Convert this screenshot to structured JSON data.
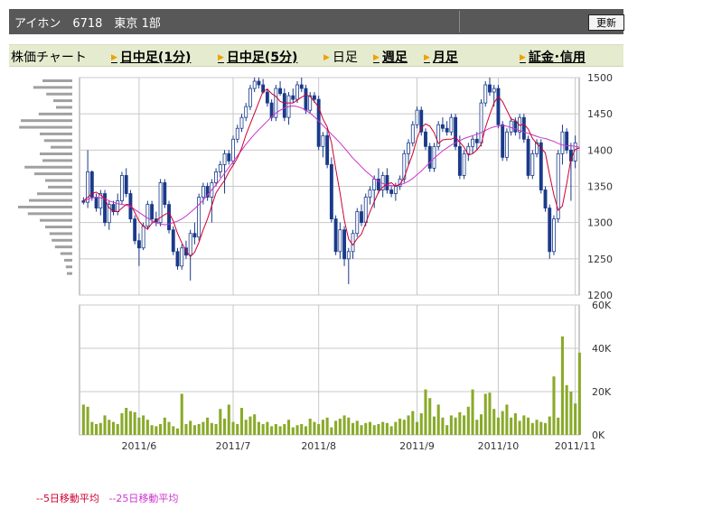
{
  "header": {
    "title": "アイホン　6718　東京 1部",
    "refresh_label": "更新"
  },
  "tabs": [
    {
      "label": "株価チャート",
      "link": false,
      "arrow": false
    },
    {
      "label": "日中足(1分)",
      "link": true,
      "arrow": true
    },
    {
      "label": "日中足(5分)",
      "link": true,
      "arrow": true
    },
    {
      "label": "日足",
      "link": false,
      "arrow": true
    },
    {
      "label": "週足",
      "link": true,
      "arrow": true
    },
    {
      "label": "月足",
      "link": true,
      "arrow": true
    },
    {
      "label": "証金･信用",
      "link": true,
      "arrow": true
    }
  ],
  "colors": {
    "up_candle": "#ffffff",
    "down_candle": "#1a3a8a",
    "ma5": "#cc0033",
    "ma25": "#cc33cc",
    "volume": "#8aaa2a",
    "volume_profile": "#a0a0a0",
    "grid": "#c8c8c8"
  },
  "legend": [
    {
      "label": "--5日移動平均",
      "color": "#cc0033"
    },
    {
      "label": "--25日移動平均",
      "color": "#cc33cc"
    }
  ],
  "chart_data": [
    {
      "type": "candlestick",
      "y_ticks": [
        "1500",
        "1450",
        "1400",
        "1350",
        "1300",
        "1250",
        "1200"
      ],
      "ylim": [
        1200,
        1500
      ],
      "x_tick_labels": [
        "2011/6",
        "2011/7",
        "2011/8",
        "2011/9",
        "2011/10",
        "2011/11"
      ],
      "x_tick_index": [
        13,
        35,
        55,
        78,
        97,
        115
      ],
      "ohlc": [
        [
          1330,
          1335,
          1325,
          1328
        ],
        [
          1328,
          1400,
          1320,
          1370
        ],
        [
          1370,
          1372,
          1330,
          1335
        ],
        [
          1335,
          1340,
          1315,
          1320
        ],
        [
          1320,
          1345,
          1310,
          1340
        ],
        [
          1340,
          1345,
          1295,
          1300
        ],
        [
          1300,
          1330,
          1290,
          1325
        ],
        [
          1325,
          1330,
          1310,
          1315
        ],
        [
          1315,
          1340,
          1310,
          1330
        ],
        [
          1330,
          1370,
          1325,
          1365
        ],
        [
          1365,
          1375,
          1335,
          1340
        ],
        [
          1340,
          1345,
          1300,
          1305
        ],
        [
          1305,
          1310,
          1270,
          1275
        ],
        [
          1275,
          1285,
          1240,
          1265
        ],
        [
          1265,
          1300,
          1262,
          1295
        ],
        [
          1295,
          1330,
          1290,
          1325
        ],
        [
          1325,
          1330,
          1300,
          1305
        ],
        [
          1305,
          1315,
          1295,
          1300
        ],
        [
          1300,
          1360,
          1295,
          1355
        ],
        [
          1355,
          1360,
          1320,
          1325
        ],
        [
          1325,
          1330,
          1285,
          1290
        ],
        [
          1290,
          1295,
          1255,
          1260
        ],
        [
          1260,
          1265,
          1235,
          1240
        ],
        [
          1240,
          1270,
          1235,
          1265
        ],
        [
          1265,
          1275,
          1250,
          1255
        ],
        [
          1255,
          1290,
          1220,
          1285
        ],
        [
          1285,
          1300,
          1270,
          1280
        ],
        [
          1280,
          1340,
          1275,
          1335
        ],
        [
          1335,
          1355,
          1325,
          1350
        ],
        [
          1350,
          1355,
          1330,
          1335
        ],
        [
          1335,
          1360,
          1300,
          1355
        ],
        [
          1355,
          1375,
          1350,
          1370
        ],
        [
          1370,
          1385,
          1362,
          1380
        ],
        [
          1380,
          1400,
          1340,
          1395
        ],
        [
          1395,
          1400,
          1380,
          1385
        ],
        [
          1385,
          1420,
          1380,
          1415
        ],
        [
          1415,
          1435,
          1410,
          1430
        ],
        [
          1430,
          1450,
          1425,
          1445
        ],
        [
          1445,
          1465,
          1440,
          1460
        ],
        [
          1460,
          1490,
          1455,
          1485
        ],
        [
          1485,
          1500,
          1480,
          1495
        ],
        [
          1495,
          1500,
          1485,
          1490
        ],
        [
          1490,
          1498,
          1478,
          1480
        ],
        [
          1480,
          1485,
          1460,
          1465
        ],
        [
          1465,
          1470,
          1440,
          1445
        ],
        [
          1445,
          1490,
          1440,
          1485
        ],
        [
          1485,
          1495,
          1475,
          1478
        ],
        [
          1478,
          1485,
          1440,
          1445
        ],
        [
          1445,
          1480,
          1435,
          1475
        ],
        [
          1475,
          1485,
          1465,
          1470
        ],
        [
          1470,
          1495,
          1465,
          1490
        ],
        [
          1490,
          1500,
          1480,
          1485
        ],
        [
          1485,
          1490,
          1450,
          1455
        ],
        [
          1455,
          1480,
          1450,
          1475
        ],
        [
          1475,
          1480,
          1465,
          1470
        ],
        [
          1470,
          1475,
          1400,
          1405
        ],
        [
          1405,
          1425,
          1390,
          1420
        ],
        [
          1420,
          1430,
          1375,
          1380
        ],
        [
          1380,
          1390,
          1300,
          1305
        ],
        [
          1305,
          1310,
          1255,
          1260
        ],
        [
          1260,
          1300,
          1250,
          1290
        ],
        [
          1290,
          1295,
          1240,
          1250
        ],
        [
          1250,
          1265,
          1215,
          1260
        ],
        [
          1260,
          1290,
          1250,
          1285
        ],
        [
          1285,
          1320,
          1280,
          1315
        ],
        [
          1315,
          1325,
          1295,
          1300
        ],
        [
          1300,
          1340,
          1295,
          1335
        ],
        [
          1335,
          1350,
          1325,
          1345
        ],
        [
          1345,
          1365,
          1320,
          1360
        ],
        [
          1360,
          1375,
          1340,
          1345
        ],
        [
          1345,
          1370,
          1335,
          1365
        ],
        [
          1365,
          1375,
          1340,
          1345
        ],
        [
          1345,
          1350,
          1335,
          1340
        ],
        [
          1340,
          1355,
          1330,
          1350
        ],
        [
          1350,
          1365,
          1345,
          1360
        ],
        [
          1360,
          1400,
          1355,
          1395
        ],
        [
          1395,
          1415,
          1380,
          1410
        ],
        [
          1410,
          1440,
          1405,
          1435
        ],
        [
          1435,
          1460,
          1430,
          1455
        ],
        [
          1455,
          1460,
          1420,
          1425
        ],
        [
          1425,
          1430,
          1400,
          1405
        ],
        [
          1405,
          1410,
          1370,
          1375
        ],
        [
          1375,
          1410,
          1370,
          1405
        ],
        [
          1405,
          1440,
          1400,
          1435
        ],
        [
          1435,
          1445,
          1425,
          1430
        ],
        [
          1430,
          1440,
          1420,
          1425
        ],
        [
          1425,
          1450,
          1420,
          1445
        ],
        [
          1445,
          1450,
          1400,
          1405
        ],
        [
          1405,
          1420,
          1360,
          1365
        ],
        [
          1365,
          1400,
          1360,
          1395
        ],
        [
          1395,
          1410,
          1385,
          1405
        ],
        [
          1405,
          1420,
          1395,
          1415
        ],
        [
          1415,
          1425,
          1400,
          1410
        ],
        [
          1410,
          1470,
          1405,
          1465
        ],
        [
          1465,
          1495,
          1460,
          1490
        ],
        [
          1490,
          1500,
          1475,
          1480
        ],
        [
          1480,
          1490,
          1460,
          1485
        ],
        [
          1485,
          1490,
          1430,
          1435
        ],
        [
          1435,
          1440,
          1385,
          1390
        ],
        [
          1390,
          1430,
          1385,
          1425
        ],
        [
          1425,
          1445,
          1420,
          1440
        ],
        [
          1440,
          1445,
          1420,
          1425
        ],
        [
          1425,
          1450,
          1415,
          1445
        ],
        [
          1445,
          1450,
          1410,
          1415
        ],
        [
          1415,
          1420,
          1360,
          1365
        ],
        [
          1365,
          1400,
          1360,
          1395
        ],
        [
          1395,
          1415,
          1390,
          1410
        ],
        [
          1410,
          1415,
          1340,
          1345
        ],
        [
          1345,
          1350,
          1315,
          1320
        ],
        [
          1320,
          1325,
          1250,
          1260
        ],
        [
          1260,
          1310,
          1255,
          1305
        ],
        [
          1305,
          1400,
          1300,
          1395
        ],
        [
          1395,
          1435,
          1380,
          1425
        ],
        [
          1425,
          1430,
          1395,
          1400
        ],
        [
          1400,
          1410,
          1330,
          1385
        ],
        [
          1385,
          1420,
          1375,
          1410
        ]
      ],
      "ma5": [
        1330,
        1335,
        1340,
        1342,
        1338,
        1333,
        1320,
        1316,
        1315,
        1320,
        1325,
        1325,
        1314,
        1302,
        1295,
        1291,
        1299,
        1303,
        1307,
        1311,
        1314,
        1302,
        1285,
        1272,
        1261,
        1253,
        1259,
        1273,
        1290,
        1305,
        1323,
        1341,
        1350,
        1358,
        1370,
        1379,
        1389,
        1403,
        1421,
        1436,
        1451,
        1466,
        1481,
        1484,
        1478,
        1474,
        1467,
        1465,
        1465,
        1465,
        1469,
        1473,
        1476,
        1474,
        1467,
        1459,
        1443,
        1432,
        1410,
        1374,
        1341,
        1303,
        1277,
        1269,
        1278,
        1284,
        1299,
        1315,
        1329,
        1342,
        1349,
        1353,
        1355,
        1350,
        1353,
        1362,
        1379,
        1395,
        1416,
        1431,
        1436,
        1433,
        1424,
        1409,
        1414,
        1415,
        1415,
        1418,
        1411,
        1404,
        1393,
        1395,
        1400,
        1408,
        1431,
        1449,
        1465,
        1474,
        1467,
        1455,
        1443,
        1441,
        1434,
        1436,
        1429,
        1416,
        1409,
        1403,
        1396,
        1366,
        1338,
        1317,
        1323,
        1354,
        1388,
        1401,
        1403
      ],
      "ma25": [
        1330,
        1332,
        1334,
        1335,
        1334,
        1333,
        1330,
        1328,
        1326,
        1325,
        1324,
        1322,
        1318,
        1314,
        1310,
        1306,
        1303,
        1300,
        1298,
        1297,
        1298,
        1300,
        1302,
        1305,
        1309,
        1314,
        1319,
        1325,
        1331,
        1338,
        1345,
        1352,
        1360,
        1368,
        1376,
        1384,
        1392,
        1400,
        1408,
        1415,
        1422,
        1428,
        1434,
        1440,
        1446,
        1451,
        1455,
        1458,
        1460,
        1461,
        1460,
        1458,
        1455,
        1451,
        1446,
        1440,
        1434,
        1428,
        1422,
        1416,
        1410,
        1403,
        1396,
        1389,
        1383,
        1377,
        1371,
        1366,
        1361,
        1357,
        1354,
        1352,
        1351,
        1351,
        1352,
        1354,
        1357,
        1361,
        1366,
        1371,
        1377,
        1383,
        1389,
        1394,
        1399,
        1403,
        1407,
        1410,
        1413,
        1416,
        1418,
        1420,
        1422,
        1424,
        1427,
        1430,
        1432,
        1433,
        1434,
        1433,
        1431,
        1429,
        1427,
        1425,
        1423,
        1421,
        1419,
        1417,
        1416,
        1414,
        1412,
        1409,
        1407,
        1406,
        1406,
        1405,
        1404
      ],
      "volume_profile": [
        0.55,
        0.72,
        0.48,
        0.35,
        0.3,
        0.62,
        0.95,
        0.98,
        0.6,
        0.52,
        0.4,
        0.6,
        0.55,
        0.88,
        0.7,
        0.5,
        0.45,
        0.65,
        0.8,
        1.0,
        0.82,
        0.6,
        0.5,
        0.42,
        0.38,
        0.32,
        0.22,
        0.15,
        0.12,
        0.1
      ]
    },
    {
      "type": "bar",
      "y_ticks": [
        "60K",
        "40K",
        "20K",
        "0K"
      ],
      "ylim": [
        0,
        60000
      ],
      "values": [
        14000,
        13000,
        6000,
        5000,
        5500,
        9000,
        7000,
        6000,
        5000,
        10000,
        12500,
        11000,
        10500,
        8000,
        9000,
        7000,
        4500,
        4000,
        5000,
        8000,
        6000,
        4000,
        3000,
        19000,
        5000,
        6500,
        4500,
        5000,
        6000,
        8000,
        5500,
        5000,
        12000,
        7500,
        14000,
        6000,
        5000,
        12500,
        7000,
        8500,
        9500,
        6000,
        5000,
        6000,
        4000,
        5000,
        4000,
        5000,
        7000,
        3500,
        4500,
        5000,
        4000,
        7500,
        6000,
        5000,
        7000,
        8000,
        3500,
        6500,
        7500,
        9000,
        8000,
        5500,
        6500,
        4500,
        5500,
        6000,
        4500,
        5000,
        6000,
        5500,
        4000,
        6000,
        7500,
        7000,
        9000,
        11000,
        6000,
        10000,
        21000,
        17000,
        8500,
        14000,
        8000,
        4500,
        9000,
        8000,
        10500,
        9000,
        13000,
        21000,
        7000,
        9500,
        19000,
        19500,
        12000,
        8000,
        11000,
        14000,
        8000,
        10000,
        6500,
        9000,
        8000,
        5500,
        7000,
        6000,
        5500,
        8500,
        27000,
        8000,
        45500,
        23000,
        20000,
        14500,
        38000
      ]
    }
  ]
}
